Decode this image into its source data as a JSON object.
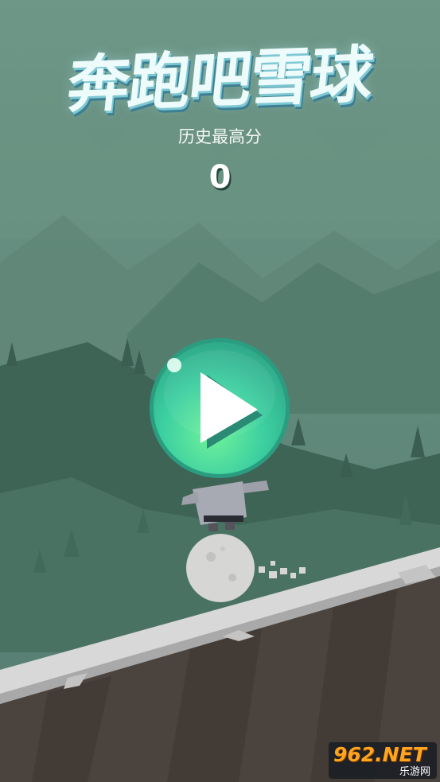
{
  "game": {
    "title": "奔跑吧雪球",
    "hiscore_label": "历史最高分",
    "hiscore_value": "0"
  },
  "play_button": {
    "icon": "play-icon",
    "color": "#3fc9a0"
  },
  "watermark": {
    "logo": "962.NET",
    "sub": "乐游网"
  },
  "colors": {
    "sky": "#5f8a7e",
    "ground": "#4b433d",
    "snow": "#dcdcdc",
    "button": "#3fc9a0"
  }
}
